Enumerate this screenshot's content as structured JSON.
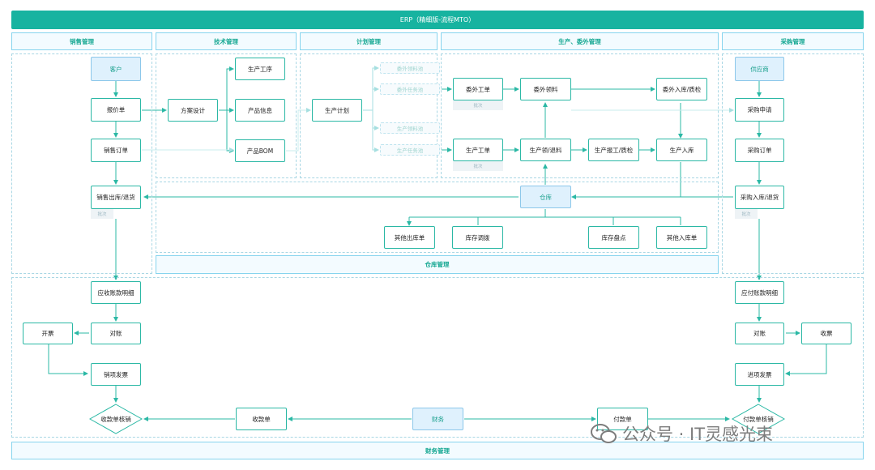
{
  "title": "ERP（精细版-流程MTO）",
  "headers": {
    "sales": "销售管理",
    "tech": "技术管理",
    "plan": "计划管理",
    "production": "生产、委外管理",
    "purchase": "采购管理"
  },
  "nodes": {
    "customer": "客户",
    "quote": "报价单",
    "sales_order": "销售订单",
    "sales_outbound": "销售出库/退货",
    "design": "方案设计",
    "process": "生产工序",
    "product_info": "产品信息",
    "bom": "产品BOM",
    "prod_plan": "生产计划",
    "out_material_pool": "委外领料池",
    "out_task_pool": "委外任务池",
    "prod_material_pool": "生产领料池",
    "prod_task_pool": "生产任务池",
    "out_order": "委外工单",
    "out_material": "委外领料",
    "out_inbound": "委外入库/质检",
    "prod_order": "生产工单",
    "prod_material": "生产领/退料",
    "prod_report": "生产报工/质检",
    "prod_inbound": "生产入库",
    "warehouse": "仓库",
    "other_out": "其他出库单",
    "transfer": "库存调拨",
    "stocktake": "库存盘点",
    "other_in": "其他入库单",
    "supplier": "供应商",
    "purchase_req": "采购申请",
    "purchase_order": "采购订单",
    "purchase_inbound": "采购入库/退货",
    "ar_detail": "应收账款明细",
    "invoice": "开票",
    "reconcile_ar": "对账",
    "sales_invoice": "销项发票",
    "receipt_writeoff": "收款单核销",
    "receipt": "收款单",
    "finance": "财务",
    "payment": "付款单",
    "payment_writeoff": "付款单核销",
    "ap_detail": "应付账款明细",
    "reconcile_ap": "对账",
    "receive_ticket": "收票",
    "purchase_invoice": "进项发票"
  },
  "tags": {
    "batch_out": "批次",
    "batch_prod": "批次",
    "batch_sales": "批次",
    "batch_purchase": "批次"
  },
  "footers": {
    "warehouse_mgmt": "仓库管理",
    "finance_mgmt": "财务管理"
  },
  "watermark": "公众号 · IT灵感光束",
  "colors": {
    "primary": "#17b3a0",
    "node_border": "#2bb8a5",
    "highlight_fill": "#dff1fd",
    "header_border": "#86d4ee"
  }
}
